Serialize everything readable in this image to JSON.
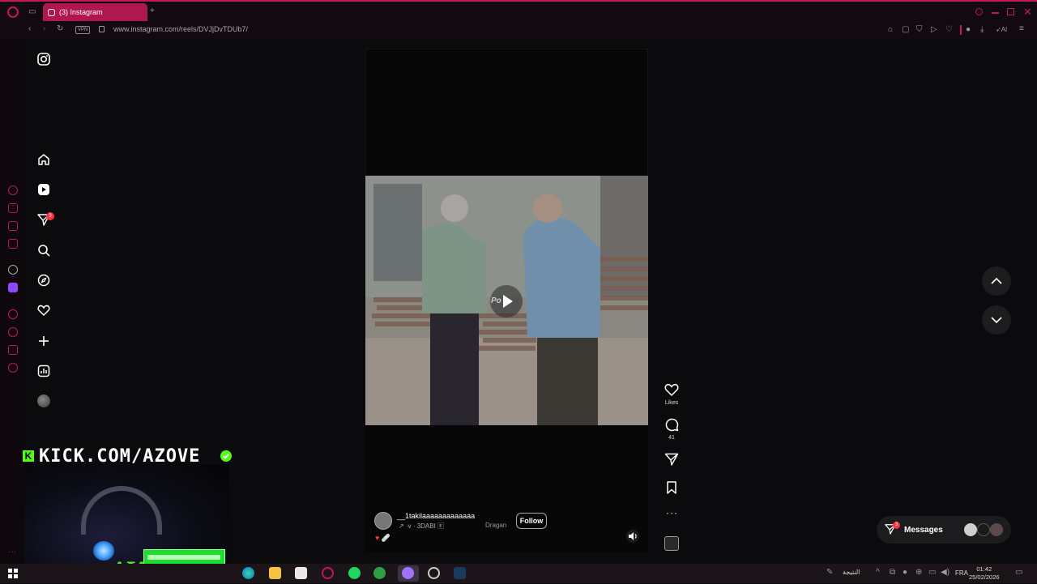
{
  "browser": {
    "tab_title": "(3) Instagram",
    "url": "www.instagram.com/reels/DVJjDvTDUb7/",
    "vpn_label": "VPN",
    "ai_label": "AI",
    "accent": "#c2185b"
  },
  "ig_sidebar": {
    "items": [
      {
        "name": "home-icon"
      },
      {
        "name": "reels-icon"
      },
      {
        "name": "messages-icon",
        "badge": "3"
      },
      {
        "name": "search-icon"
      },
      {
        "name": "explore-icon"
      },
      {
        "name": "notifications-icon"
      },
      {
        "name": "create-icon"
      },
      {
        "name": "dashboard-icon"
      },
      {
        "name": "profile-avatar"
      }
    ]
  },
  "reel": {
    "username": "__1takilaaaaaaaaaaaaa",
    "audio_line": "↗ ·v · 3DABI 🄴",
    "audio_source": "Dragan",
    "follow_label": "Follow",
    "emoji_caption": "♥ 🩹",
    "overlay_text": "Po"
  },
  "actions": {
    "likes_label": "Likes",
    "comments_count": "41"
  },
  "messages": {
    "label": "Messages",
    "badge": "3"
  },
  "stream_overlay": {
    "kick_logo": "K",
    "kick_url": "KICK.COM/AZOVE",
    "logo_text": "AW",
    "brand_color": "#53fc18"
  },
  "taskbar": {
    "arabic_text": "النتيجة",
    "language": "FRA",
    "time": "01:42",
    "date": "25/02/2026"
  }
}
